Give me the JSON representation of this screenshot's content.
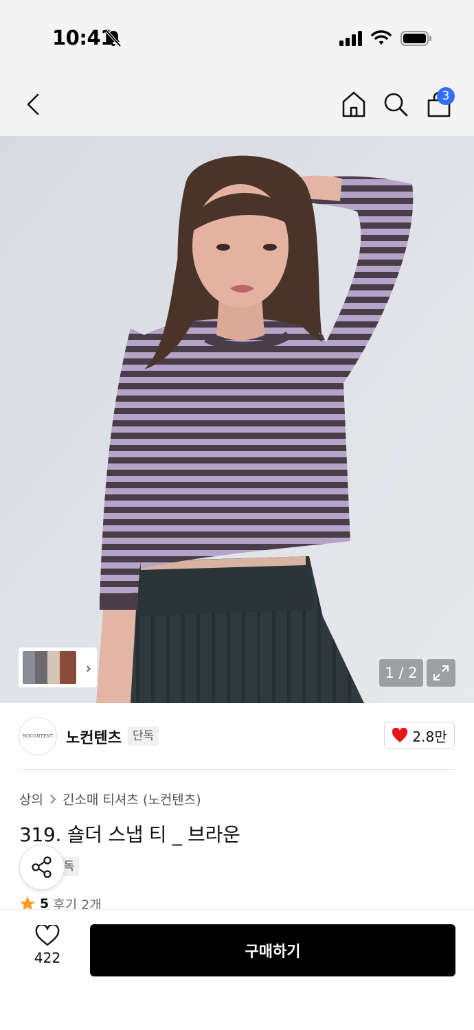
{
  "status_bar": {
    "time": "10:41",
    "icons": [
      "bell-slash-icon",
      "cellular-signal-icon",
      "wifi-icon",
      "battery-icon"
    ]
  },
  "nav": {
    "icons": [
      "back-chevron-icon",
      "home-icon",
      "search-icon",
      "shopping-bag-icon"
    ],
    "cart_count": "3",
    "accent_color": "#2f6fff"
  },
  "gallery": {
    "counter": "1 / 2",
    "thumbnail_arrow": "›",
    "expand_icon": "expand-arrows-icon"
  },
  "brand": {
    "logo_text": "NOCONTENT",
    "name": "노컨텐츠",
    "tag": "단독",
    "likes": "2.8만",
    "heart_color": "#e5141d"
  },
  "product": {
    "breadcrumb": [
      "상의",
      "긴소매 티셔츠 (노컨텐츠)"
    ],
    "title": "319. 숄더 스냅 티 _ 브라운",
    "exclusive_tag": "단독",
    "rating": "5",
    "review_text": "후기 2개",
    "star_color": "#ff9a1f"
  },
  "bottom_bar": {
    "wish_count": "422",
    "buy_label": "구매하기"
  }
}
